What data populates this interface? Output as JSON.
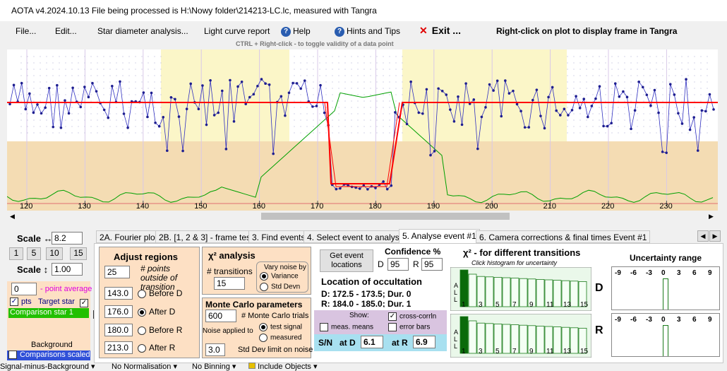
{
  "window": {
    "title": "AOTA v4.2024.10.13    File being processed is H:\\Nowy folder\\214213-LC.lc, measured with Tangra"
  },
  "menu": {
    "file": "File...",
    "edit": "Edit...",
    "star_diameter": "Star diameter analysis...",
    "light_curve": "Light curve report",
    "help": "Help",
    "hints": "Hints and Tips",
    "exit": "Exit ...",
    "right_click_note": "Right-click on plot to display frame in Tangra"
  },
  "hint": "CTRL + Right-click  -  to toggle validity of a data point",
  "plot": {
    "x_ticks": [
      "120",
      "130",
      "140",
      "150",
      "160",
      "170",
      "180",
      "190",
      "200",
      "210",
      "220",
      "230"
    ]
  },
  "left": {
    "scale_h_label": "Scale ↔",
    "scale_h_value": "8.2",
    "btn1": "1",
    "btn5": "5",
    "btn10": "10",
    "btn15": "15",
    "scale_v_label": "Scale ↕",
    "scale_v_value": "1.00",
    "point_avg_value": "0",
    "point_avg_label": "- point average",
    "pts_label": "pts",
    "target_label": "Target star",
    "comparison1": "Comparison star 1",
    "background": "Background",
    "comparisons_scaled": "Comparisons scaled"
  },
  "tabs": [
    "2A. Fourier plot",
    "2B. [1, 2 & 3] - frame test",
    "3. Find events",
    "4. Select event to analyse",
    "5. Analyse event #1",
    "6. Camera corrections & final times Event #1"
  ],
  "adjust": {
    "title": "Adjust regions",
    "points_value": "25",
    "points_label": "# points outside of transition",
    "before_d_value": "143.0",
    "before_d": "Before D",
    "after_d_value": "176.0",
    "after_d": "After D",
    "before_r_value": "180.0",
    "before_r": "Before R",
    "after_r_value": "213.0",
    "after_r": "After R"
  },
  "chi": {
    "title": "χ² analysis",
    "transitions_label": "# transitions",
    "transitions_value": "15",
    "vary_title": "Vary noise by",
    "variance": "Variance",
    "std_devn": "Std Devn"
  },
  "monte": {
    "title": "Monte Carlo parameters",
    "trials_value": "600",
    "trials_label": "# Monte Carlo trials",
    "noise_label": "Noise applied to",
    "test_signal": "test signal",
    "measured": "measured",
    "std_value": "3.0",
    "std_label": "Std Dev limit on noise"
  },
  "event": {
    "get_btn": "Get event locations",
    "conf_title": "Confidence %",
    "d_label": "D",
    "d_value": "95",
    "r_label": "R",
    "r_value": "95",
    "location_title": "Location of occultation",
    "d_line": "D: 172.5 - 173.5; Dur. 0",
    "r_line": "R: 184.0 - 185.0; Dur. 1",
    "show_label": "Show:",
    "meas_means": "meas. means",
    "cross_corr": "cross-corrln",
    "error_bars": "error bars",
    "sn_label": "S/N",
    "at_d_label": "at D",
    "at_d_value": "6.1",
    "at_r_label": "at R",
    "at_r_value": "6.9"
  },
  "chi2trans": {
    "title": "χ² - for different transitions",
    "subtitle": "Click histogram for uncertainty",
    "all": "A L L",
    "xlabels": [
      "1",
      "3",
      "5",
      "7",
      "9",
      "11",
      "13",
      "15"
    ],
    "D": "D",
    "R": "R"
  },
  "uncert": {
    "title": "Uncertainty range",
    "labels": [
      "-9",
      "-6",
      "-3",
      "0",
      "3",
      "6",
      "9"
    ]
  },
  "status": {
    "signal": "Signal-minus-Background",
    "norm": "No Normalisation",
    "binning": "No Binning",
    "include": "Include Objects"
  },
  "colors": {
    "yellow": "#fbf6c8",
    "tan": "#f4dcb3",
    "red": "#ff0000",
    "green": "#007d00",
    "blue": "#1e1ea0",
    "accent": "#fde0c4"
  }
}
